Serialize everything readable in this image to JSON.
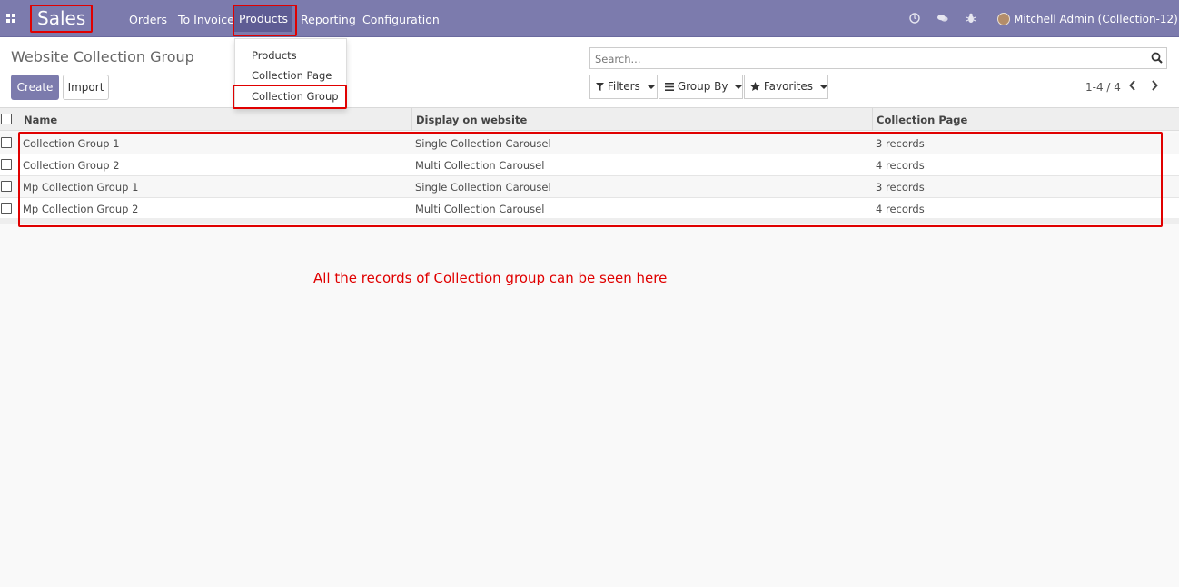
{
  "navbar": {
    "brand": "Sales",
    "menu": [
      "Orders",
      "To Invoice",
      "Products",
      "Reporting",
      "Configuration"
    ],
    "user": "Mitchell Admin (Collection-12)",
    "icons": [
      "apps-icon",
      "clock-icon",
      "chat-icon",
      "bug-icon"
    ]
  },
  "dropdown": {
    "items": [
      "Products",
      "Collection Page",
      "Collection Group"
    ]
  },
  "control": {
    "title": "Website Collection Group",
    "create": "Create",
    "import": "Import",
    "search_placeholder": "Search...",
    "filters": "Filters",
    "group_by": "Group By",
    "favorites": "Favorites",
    "pager": "1-4 / 4"
  },
  "table": {
    "headers": [
      "Name",
      "Display on website",
      "Collection Page"
    ],
    "rows": [
      [
        "Collection Group 1",
        "Single Collection Carousel",
        "3 records"
      ],
      [
        "Collection Group 2",
        "Multi Collection Carousel",
        "4 records"
      ],
      [
        "Mp Collection Group 1",
        "Single Collection Carousel",
        "3 records"
      ],
      [
        "Mp Collection Group 2",
        "Multi Collection Carousel",
        "4 records"
      ]
    ]
  },
  "note": "All the records of Collection group can be seen here",
  "colors": {
    "navbar": "#7c7bad",
    "highlight": "#e00000"
  }
}
